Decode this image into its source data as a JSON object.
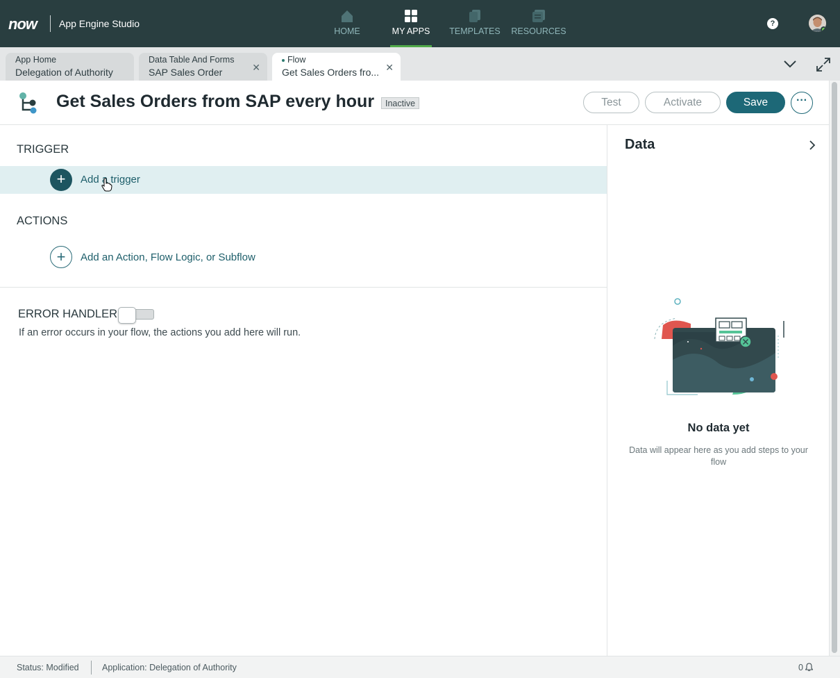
{
  "header": {
    "logo": "now",
    "app_name": "App Engine Studio",
    "nav": [
      {
        "label": "HOME",
        "icon": "home-icon",
        "active": false
      },
      {
        "label": "MY APPS",
        "icon": "grid-icon",
        "active": true
      },
      {
        "label": "TEMPLATES",
        "icon": "templates-icon",
        "active": false
      },
      {
        "label": "RESOURCES",
        "icon": "resources-icon",
        "active": false
      }
    ],
    "help": "?"
  },
  "tabs": [
    {
      "category": "App Home",
      "title": "Delegation of Authority"
    },
    {
      "category": "Data Table And Forms",
      "title": "SAP Sales Order"
    },
    {
      "category": "Flow",
      "title": "Get Sales Orders fro..."
    }
  ],
  "flow": {
    "title": "Get Sales Orders from SAP every hour",
    "status_badge": "Inactive",
    "buttons": {
      "test": "Test",
      "activate": "Activate",
      "save": "Save",
      "more": "···"
    }
  },
  "main": {
    "trigger_label": "TRIGGER",
    "add_trigger": "Add a trigger",
    "actions_label": "ACTIONS",
    "add_action": "Add an Action, Flow Logic, or Subflow",
    "error_handler_label": "ERROR HANDLER",
    "error_handler_enabled": false,
    "error_handler_desc": "If an error occurs in your flow, the actions you add here will run."
  },
  "data_panel": {
    "title": "Data",
    "empty_title": "No data yet",
    "empty_desc": "Data will appear here as you add steps to your flow"
  },
  "statusbar": {
    "status": "Status: Modified",
    "application": "Application: Delegation of Authority",
    "notifications": "0"
  },
  "colors": {
    "header_bg": "#293e40",
    "primary": "#1d6877",
    "trigger_row_bg": "#e0eff1"
  }
}
